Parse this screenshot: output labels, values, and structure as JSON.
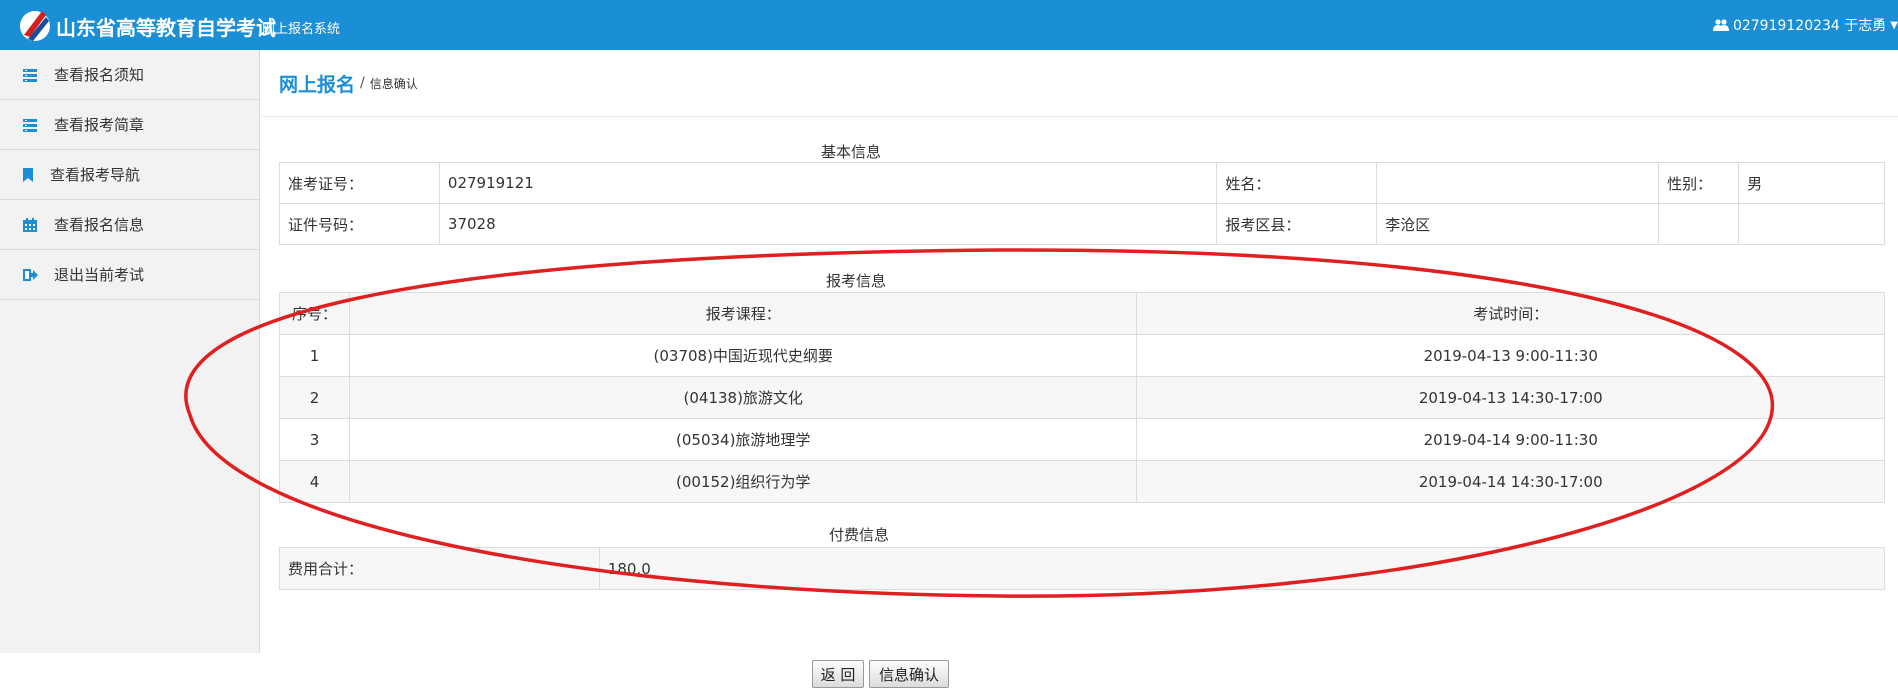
{
  "header": {
    "brand": "山东省高等教育自学考试",
    "subtitle": "网上报名系统",
    "user": "027919120234 于志勇"
  },
  "sidebar": {
    "items": [
      {
        "label": "查看报名须知",
        "icon": "list-icon"
      },
      {
        "label": "查看报考简章",
        "icon": "list-icon"
      },
      {
        "label": "查看报考导航",
        "icon": "bookmark-icon"
      },
      {
        "label": "查看报名信息",
        "icon": "calendar-icon"
      },
      {
        "label": "退出当前考试",
        "icon": "sign-out-icon"
      }
    ]
  },
  "breadcrumb": {
    "main": "网上报名",
    "separator": "/",
    "current": "信息确认"
  },
  "basic": {
    "title": "基本信息",
    "ticket_label": "准考证号：",
    "ticket_value": "027919121",
    "name_label": "姓名：",
    "name_value": "",
    "gender_label": "性别：",
    "gender_value": "男",
    "id_label": "证件号码：",
    "id_value": "37028",
    "district_label": "报考区县：",
    "district_value": "李沧区"
  },
  "courses": {
    "title": "报考信息",
    "headers": [
      "序号：",
      "报考课程：",
      "考试时间："
    ],
    "rows": [
      [
        "1",
        "(03708)中国近现代史纲要",
        "2019-04-13 9:00-11:30"
      ],
      [
        "2",
        "(04138)旅游文化",
        "2019-04-13 14:30-17:00"
      ],
      [
        "3",
        "(05034)旅游地理学",
        "2019-04-14 9:00-11:30"
      ],
      [
        "4",
        "(00152)组织行为学",
        "2019-04-14 14:30-17:00"
      ]
    ]
  },
  "fees": {
    "title": "付费信息",
    "total_label": "费用合计：",
    "total_value": "180.0"
  },
  "buttons": {
    "back": "返 回",
    "confirm": "信息确认"
  },
  "colors": {
    "header_bg": "#1a8fd6",
    "accent": "#1a8fd6",
    "annotation": "#e02020"
  }
}
